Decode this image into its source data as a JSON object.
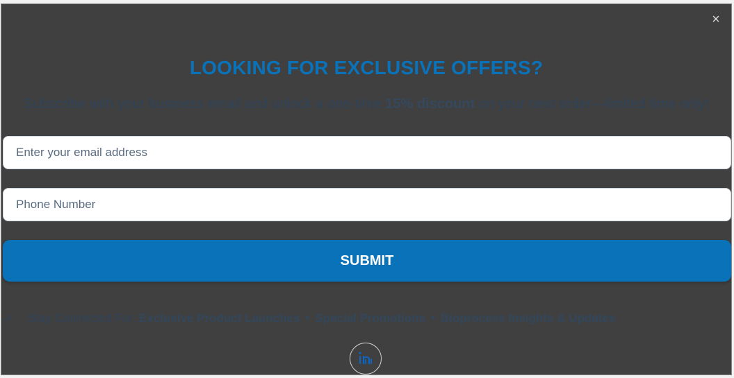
{
  "modal": {
    "close_glyph": "×",
    "headline": "LOOKING FOR EXCLUSIVE OFFERS?",
    "subtext_before": "Subscribe with your business email and unlock a one-time ",
    "subtext_bold": "15% discount",
    "subtext_after": " on your next order—limited time only!",
    "email_placeholder": "Enter your email address",
    "phone_placeholder": "Phone Number",
    "submit_label": "SUBMIT",
    "features": {
      "check_glyph": "✓",
      "label": "Stay Connected For:",
      "items": [
        "Exclusive Product Launches",
        "Special Promotions",
        "Bioprocess Insights & Updates"
      ],
      "separator": "•"
    },
    "social": {
      "icon": "linkedin-icon"
    }
  },
  "colors": {
    "overlay": "#404040",
    "accent": "#0a72b9",
    "muted_text": "#2f4258",
    "linkedin": "#0a66c2"
  }
}
